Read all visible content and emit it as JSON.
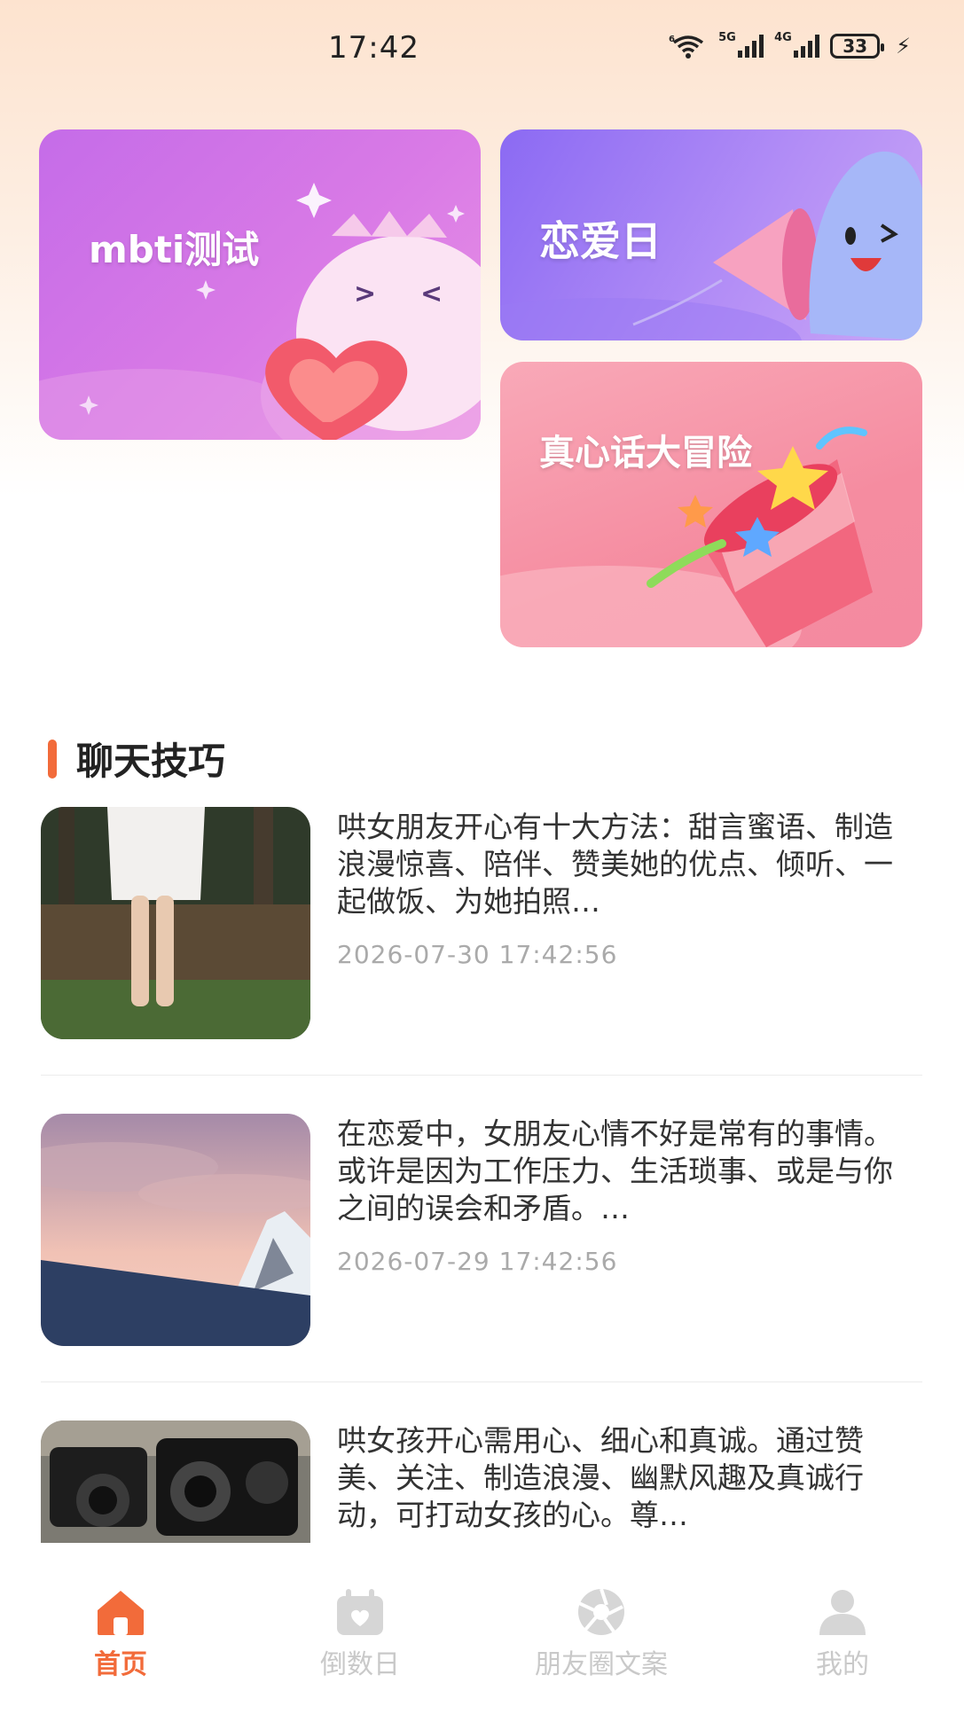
{
  "status_bar": {
    "time": "17:42",
    "wifi_tag": "6",
    "signal1_tag": "5G",
    "signal2_tag": "4G",
    "battery": "33"
  },
  "cards": {
    "mbti": "mbti测试",
    "love_day": "恋爱日",
    "truth_dare": "真心话大冒险"
  },
  "section": {
    "title": "聊天技巧"
  },
  "articles": [
    {
      "text": "哄女朋友开心有十大方法：甜言蜜语、制造浪漫惊喜、陪伴、赞美她的优点、倾听、一起做饭、为她拍照…",
      "date": "2026-07-30 17:42:56",
      "thumb": "girl-in-forest"
    },
    {
      "text": "在恋爱中，女朋友心情不好是常有的事情。或许是因为工作压力、生活琐事、或是与你之间的误会和矛盾。…",
      "date": "2026-07-29 17:42:56",
      "thumb": "mountain-sunset"
    },
    {
      "text": "哄女孩开心需用心、细心和真诚。通过赞美、关注、制造浪漫、幽默风趣及真诚行动，可打动女孩的心。尊…",
      "date": "",
      "thumb": "vintage-cameras"
    }
  ],
  "tabbar": {
    "home": "首页",
    "countdown": "倒数日",
    "moments": "朋友圈文案",
    "mine": "我的"
  },
  "colors": {
    "accent": "#f26b3a",
    "inactive": "#c9c9c9"
  }
}
